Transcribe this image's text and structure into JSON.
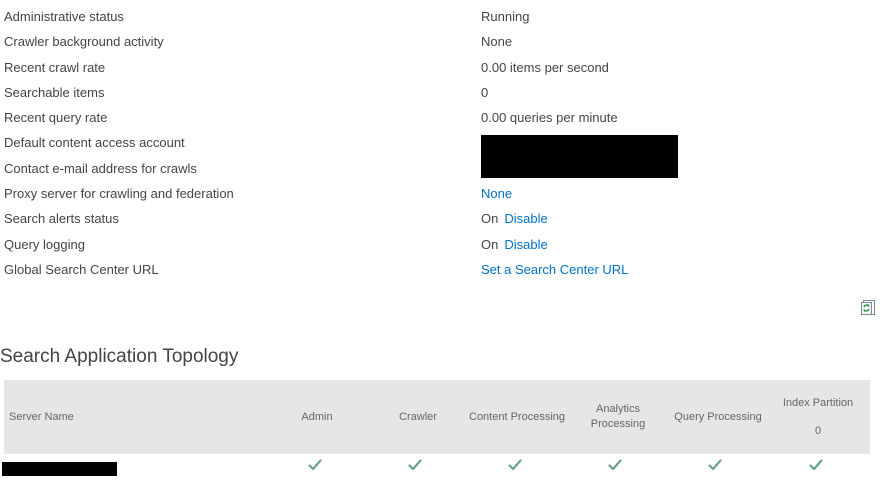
{
  "status": {
    "rows": [
      {
        "label": "Administrative status",
        "value": "Running"
      },
      {
        "label": "Crawler background activity",
        "value": "None"
      },
      {
        "label": "Recent crawl rate",
        "value": "0.00 items per second"
      },
      {
        "label": "Searchable items",
        "value": "0"
      },
      {
        "label": "Recent query rate",
        "value": "0.00 queries per minute"
      },
      {
        "label": "Default content access account",
        "value": ""
      },
      {
        "label": "Contact e-mail address for crawls",
        "value": ""
      },
      {
        "label": "Proxy server for crawling and federation",
        "link": "None"
      },
      {
        "label": "Search alerts status",
        "value": "On",
        "link": "Disable"
      },
      {
        "label": "Query logging",
        "value": "On",
        "link": "Disable"
      },
      {
        "label": "Global Search Center URL",
        "link": "Set a Search Center URL"
      }
    ]
  },
  "refresh": {
    "icon": "refresh-icon"
  },
  "topology": {
    "title": "Search Application Topology",
    "headers": {
      "server_name": "Server Name",
      "admin": "Admin",
      "crawler": "Crawler",
      "content_processing": "Content Processing",
      "analytics_processing": "Analytics Processing",
      "query_processing": "Query Processing",
      "index_partition": "Index Partition",
      "index_partition_number": "0"
    },
    "rows": [
      {
        "server_name": "",
        "admin": "check-icon",
        "crawler": "check-icon",
        "content_processing": "check-icon",
        "analytics_processing": "check-icon",
        "query_processing": "check-icon",
        "index_partition": "check-icon"
      }
    ],
    "check_color": "#6aa08a"
  }
}
